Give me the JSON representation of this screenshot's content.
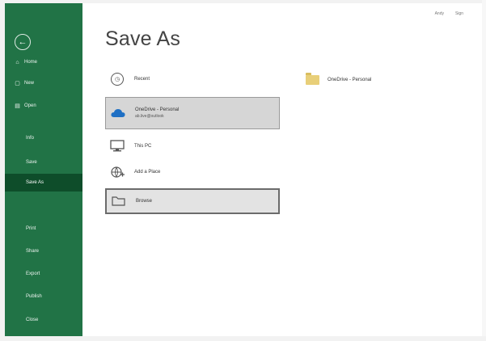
{
  "window": {
    "title": "Save As"
  },
  "account": {
    "links": [
      "Andy",
      "Sign"
    ]
  },
  "sidebar": {
    "back_icon": "back-arrow-icon",
    "items": [
      {
        "label": "Home",
        "icon": "home-icon",
        "glyph": "⌂"
      },
      {
        "label": "New",
        "icon": "new-file-icon",
        "glyph": "▢"
      },
      {
        "label": "Open",
        "icon": "folder-open-icon",
        "glyph": "▤"
      },
      {
        "label": "Info"
      },
      {
        "label": "Save"
      },
      {
        "label": "Save As",
        "active": true
      },
      {
        "label": "Print"
      },
      {
        "label": "Share"
      },
      {
        "label": "Export"
      },
      {
        "label": "Publish"
      },
      {
        "label": "Close"
      }
    ]
  },
  "locations": {
    "recent": {
      "label": "Recent",
      "icon": "clock-icon"
    },
    "onedrive": {
      "label": "OneDrive - Personal",
      "sub": "ab.live@outlook",
      "icon": "cloud-icon"
    },
    "this_pc": {
      "label": "This PC",
      "icon": "computer-icon"
    },
    "add_place": {
      "label": "Add a Place",
      "icon": "globe-plus-icon"
    },
    "browse": {
      "label": "Browse",
      "icon": "folder-browse-icon"
    }
  },
  "recent_folders": [
    {
      "label": "OneDrive - Personal",
      "icon": "folder-icon"
    }
  ],
  "colors": {
    "sidebar": "#217346",
    "sidebar_active": "#0e4d2a",
    "title": "#444444"
  }
}
